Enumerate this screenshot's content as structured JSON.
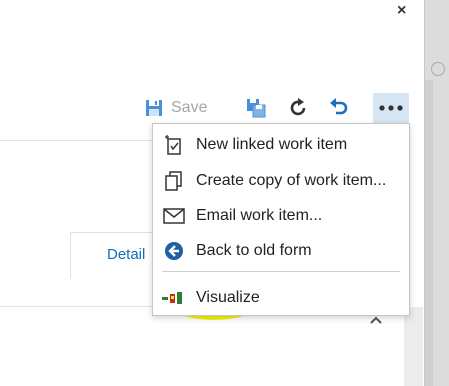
{
  "window": {
    "close_glyph": "×"
  },
  "toolbar": {
    "save_label": "Save",
    "icons": [
      "save-icon",
      "copy-workitem-icon",
      "refresh-icon",
      "undo-icon",
      "more-icon"
    ],
    "more_glyph": "•••"
  },
  "tabs": {
    "details_label": "Detail"
  },
  "menu": {
    "items": [
      {
        "label": "New linked work item",
        "icon": "new-linked-work-item-icon"
      },
      {
        "label": "Create copy of work item...",
        "icon": "copy-icon"
      },
      {
        "label": "Email work item...",
        "icon": "email-icon"
      },
      {
        "label": "Back to old form",
        "icon": "back-arrow-icon"
      },
      {
        "label": "Visualize",
        "icon": "visualize-icon"
      }
    ]
  },
  "colors": {
    "accent": "#106ebe",
    "highlight": "#f6f600",
    "more_button_bg": "#d7e6f4",
    "disabled_text": "#a6a6a6"
  }
}
